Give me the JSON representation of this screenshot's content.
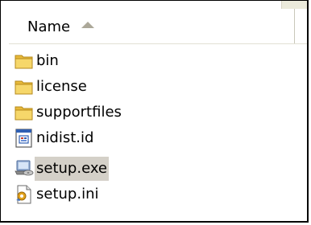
{
  "header": {
    "name_label": "Name"
  },
  "files": [
    {
      "name": "bin",
      "icon": "folder-icon",
      "selected": false
    },
    {
      "name": "license",
      "icon": "folder-icon",
      "selected": false
    },
    {
      "name": "supportfiles",
      "icon": "folder-icon",
      "selected": false
    },
    {
      "name": "nidist.id",
      "icon": "id-file-icon",
      "selected": false
    },
    {
      "name": "setup.exe",
      "icon": "installer-icon",
      "selected": true
    },
    {
      "name": "setup.ini",
      "icon": "settings-file-icon",
      "selected": false
    }
  ],
  "colors": {
    "selection": "#d4d0c8",
    "folder": "#f2cc55",
    "header_border": "#c9c7ba"
  }
}
